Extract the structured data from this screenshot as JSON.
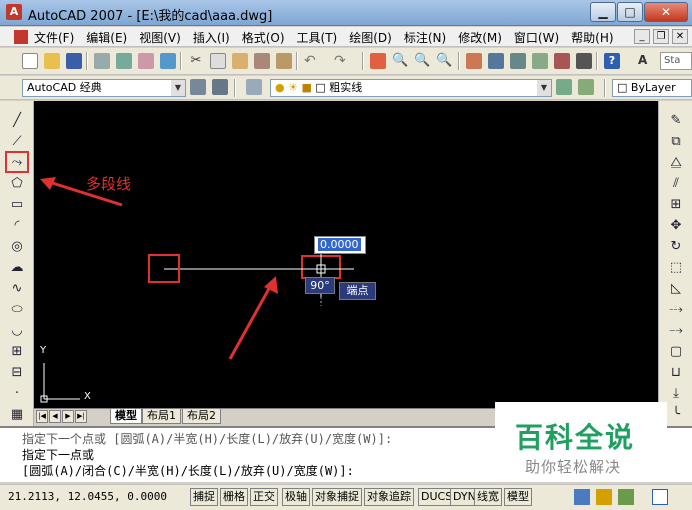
{
  "window": {
    "title": "AutoCAD 2007 - [E:\\我的cad\\aaa.dwg]",
    "app_icon": "autocad-logo"
  },
  "menu": [
    "文件(F)",
    "编辑(E)",
    "视图(V)",
    "插入(I)",
    "格式(O)",
    "工具(T)",
    "绘图(D)",
    "标注(N)",
    "修改(M)",
    "窗口(W)",
    "帮助(H)"
  ],
  "toolbar": {
    "workspace": "AutoCAD 经典",
    "layer": "粗实线",
    "color": "ByLayer",
    "text_style": "Sta"
  },
  "canvas": {
    "input_value": "0.0000",
    "angle_label": "90°",
    "snap_tooltip": "端点",
    "annotation_label": "多段线",
    "ucs_x": "X",
    "ucs_y": "Y"
  },
  "layout_tabs": [
    "模型",
    "布局1",
    "布局2"
  ],
  "command": {
    "line1": "指定下一个点或 [圆弧(A)/半宽(H)/长度(L)/放弃(U)/宽度(W)]:",
    "line2": "指定下一点或",
    "line3": "[圆弧(A)/闭合(C)/半宽(H)/长度(L)/放弃(U)/宽度(W)]:"
  },
  "status": {
    "coordinates": "21.2113, 12.0455, 0.0000",
    "buttons": [
      "捕捉",
      "栅格",
      "正交",
      "极轴",
      "对象捕捉",
      "对象追踪",
      "DUCS",
      "DYN",
      "线宽",
      "模型"
    ]
  },
  "watermark": {
    "title": "百科全说",
    "subtitle": "助你轻松解决"
  },
  "colors": {
    "canvas": "#000000",
    "highlight": "#e03030",
    "title_gradient": "#7ea6d3"
  }
}
